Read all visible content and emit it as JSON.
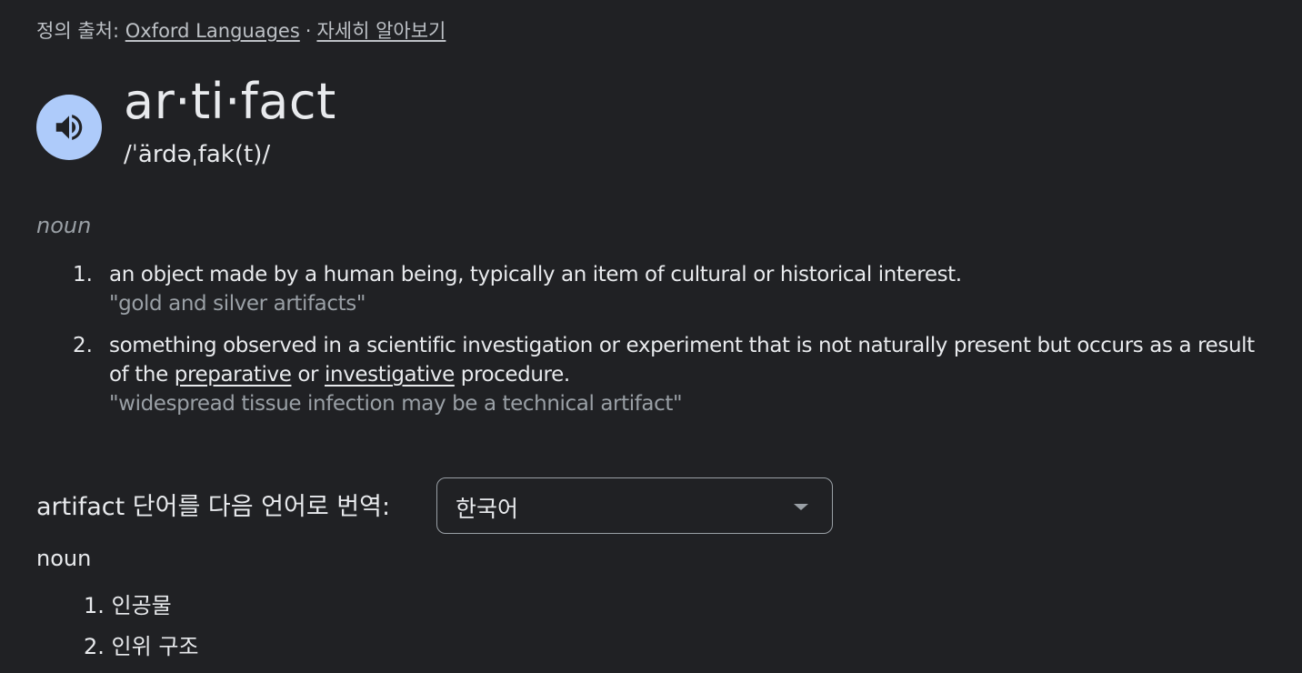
{
  "source": {
    "prefix": "정의 출처:",
    "provider": "Oxford Languages",
    "separator": "·",
    "learn_more": "자세히 알아보기"
  },
  "entry": {
    "audio_icon": "speaker-icon",
    "word": "ar·ti·fact",
    "phonetic": "/ˈärdəˌfak(t)/",
    "part_of_speech": "noun",
    "definitions": [
      {
        "number": "1.",
        "text": "an object made by a human being, typically an item of cultural or historical interest.",
        "example": "\"gold and silver artifacts\""
      },
      {
        "number": "2.",
        "text_before": "something observed in a scientific investigation or experiment that is not naturally present but occurs as a result of the ",
        "link1": "preparative",
        "text_mid": " or ",
        "link2": "investigative",
        "text_after": " procedure.",
        "example": "\"widespread tissue infection may be a technical artifact\""
      }
    ]
  },
  "translation": {
    "label": "artifact 단어를 다음 언어로 번역:",
    "selected_language": "한국어",
    "part_of_speech": "noun",
    "items": [
      {
        "label": "1. 인공물"
      },
      {
        "label": "2. 인위 구조"
      }
    ]
  },
  "colors": {
    "background": "#202124",
    "text": "#e8eaed",
    "muted": "#9aa0a6",
    "audio_button": "#aecbfa",
    "audio_icon": "#202124"
  }
}
